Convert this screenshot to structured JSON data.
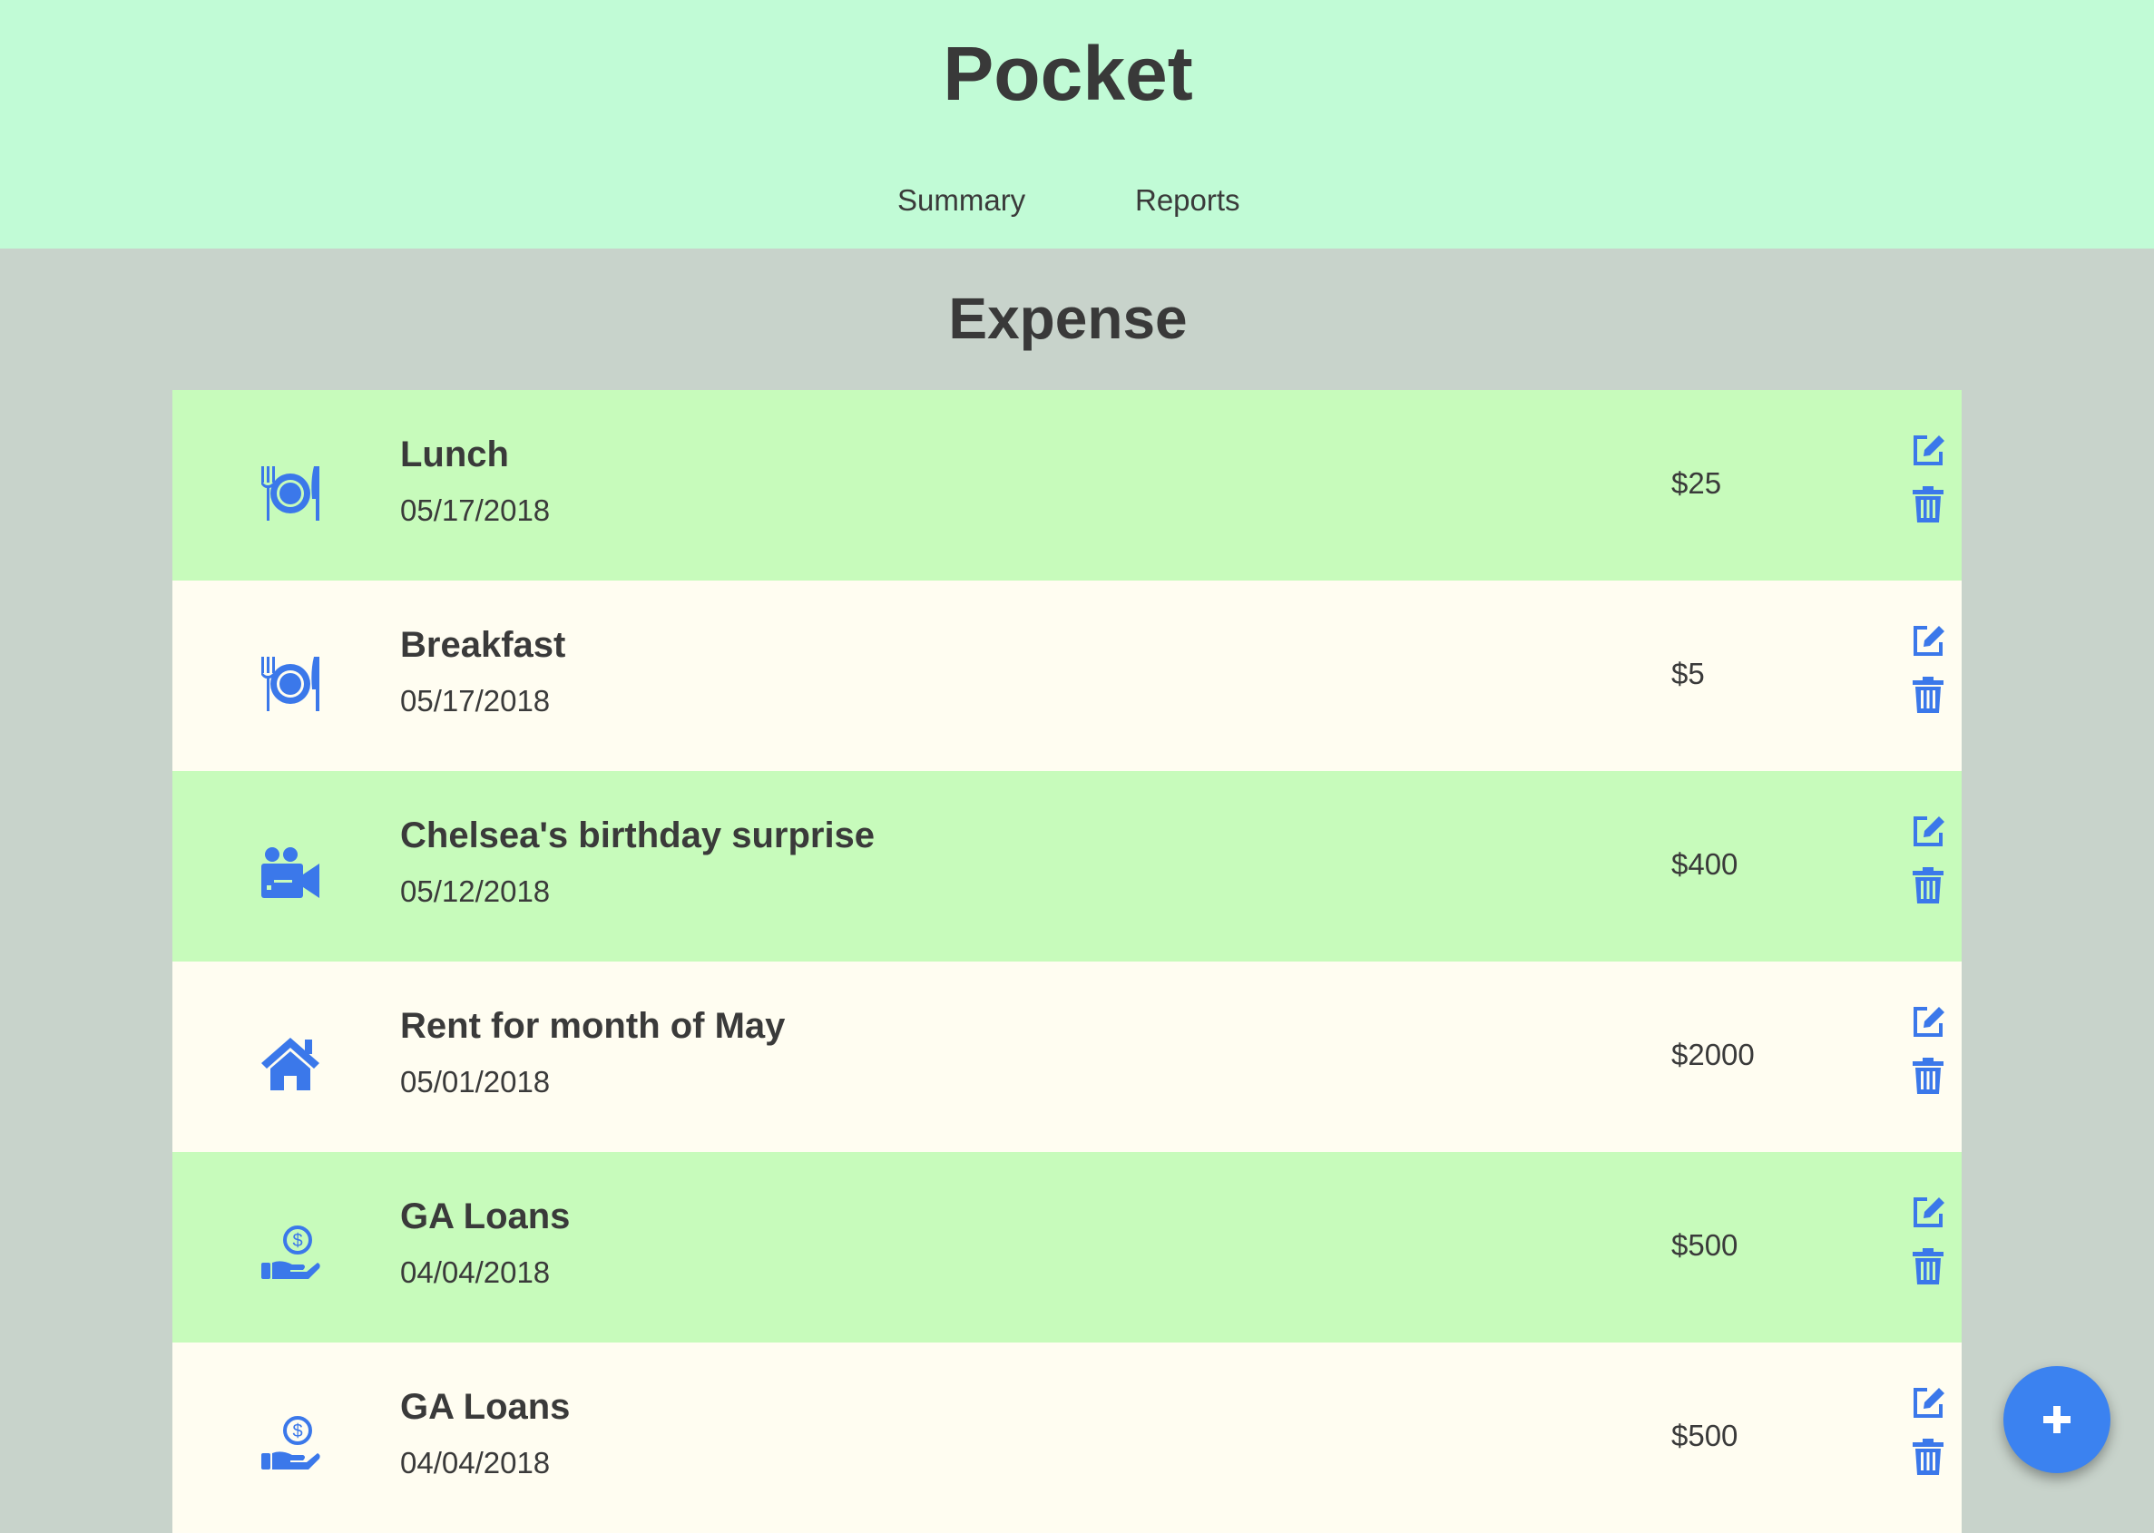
{
  "header": {
    "title": "Pocket",
    "nav": [
      {
        "label": "Summary"
      },
      {
        "label": "Reports"
      }
    ]
  },
  "main": {
    "section_title": "Expense",
    "expenses": [
      {
        "title": "Lunch",
        "date": "05/17/2018",
        "amount": "$25",
        "icon": "dining-icon"
      },
      {
        "title": "Breakfast",
        "date": "05/17/2018",
        "amount": "$5",
        "icon": "dining-icon"
      },
      {
        "title": "Chelsea's birthday surprise",
        "date": "05/12/2018",
        "amount": "$400",
        "icon": "video-camera-icon"
      },
      {
        "title": "Rent for month of May",
        "date": "05/01/2018",
        "amount": "$2000",
        "icon": "home-icon"
      },
      {
        "title": "GA Loans",
        "date": "04/04/2018",
        "amount": "$500",
        "icon": "hand-coin-icon"
      },
      {
        "title": "GA Loans",
        "date": "04/04/2018",
        "amount": "$500",
        "icon": "hand-coin-icon"
      }
    ],
    "row_actions": {
      "edit_icon": "edit-icon",
      "delete_icon": "trash-icon"
    }
  },
  "fab": {
    "icon": "plus-icon"
  },
  "colors": {
    "header_bg": "#c1fbd6",
    "page_bg": "#c8d3cb",
    "row_green": "#c7fbbb",
    "row_cream": "#fffdf1",
    "accent": "#3b82f0",
    "text": "#3a3a3a"
  }
}
